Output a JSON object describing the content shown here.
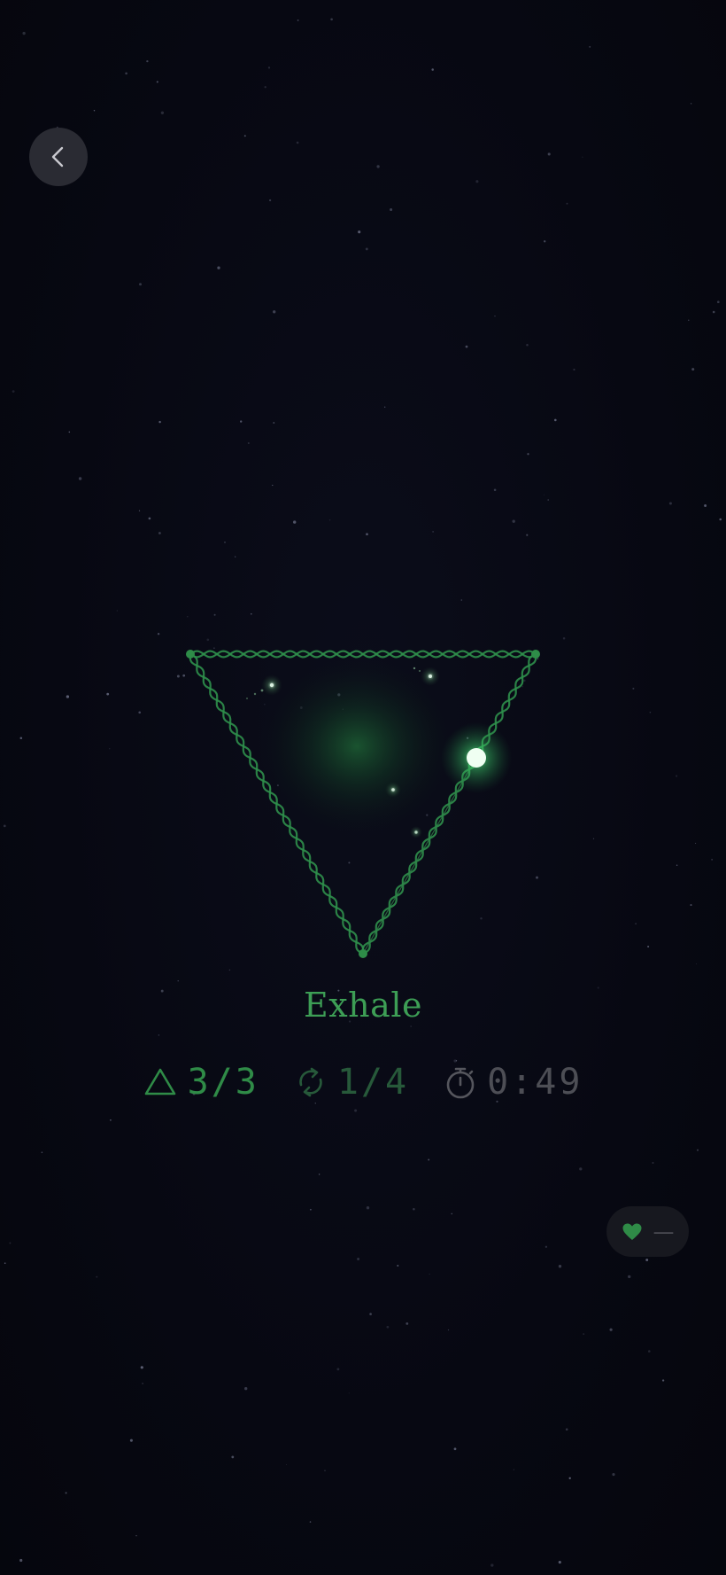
{
  "session": {
    "phase_label": "Exhale",
    "shape": "triangle",
    "progress_along_side": 0.3
  },
  "stats": {
    "sides": {
      "icon": "triangle-icon",
      "value": "3/3"
    },
    "cycles": {
      "icon": "repeat-icon",
      "value": "1/4"
    },
    "timer": {
      "icon": "stopwatch-icon",
      "value": "0:49"
    }
  },
  "heart_rate": {
    "icon": "heart-icon",
    "value": "—"
  },
  "nav": {
    "back_icon": "chevron-left-icon"
  },
  "colors": {
    "background": "#070812",
    "accent": "#3d9e55",
    "accent_bright": "#5fd47a",
    "muted": "#4d4e55",
    "button_bg": "#2a2b33"
  }
}
